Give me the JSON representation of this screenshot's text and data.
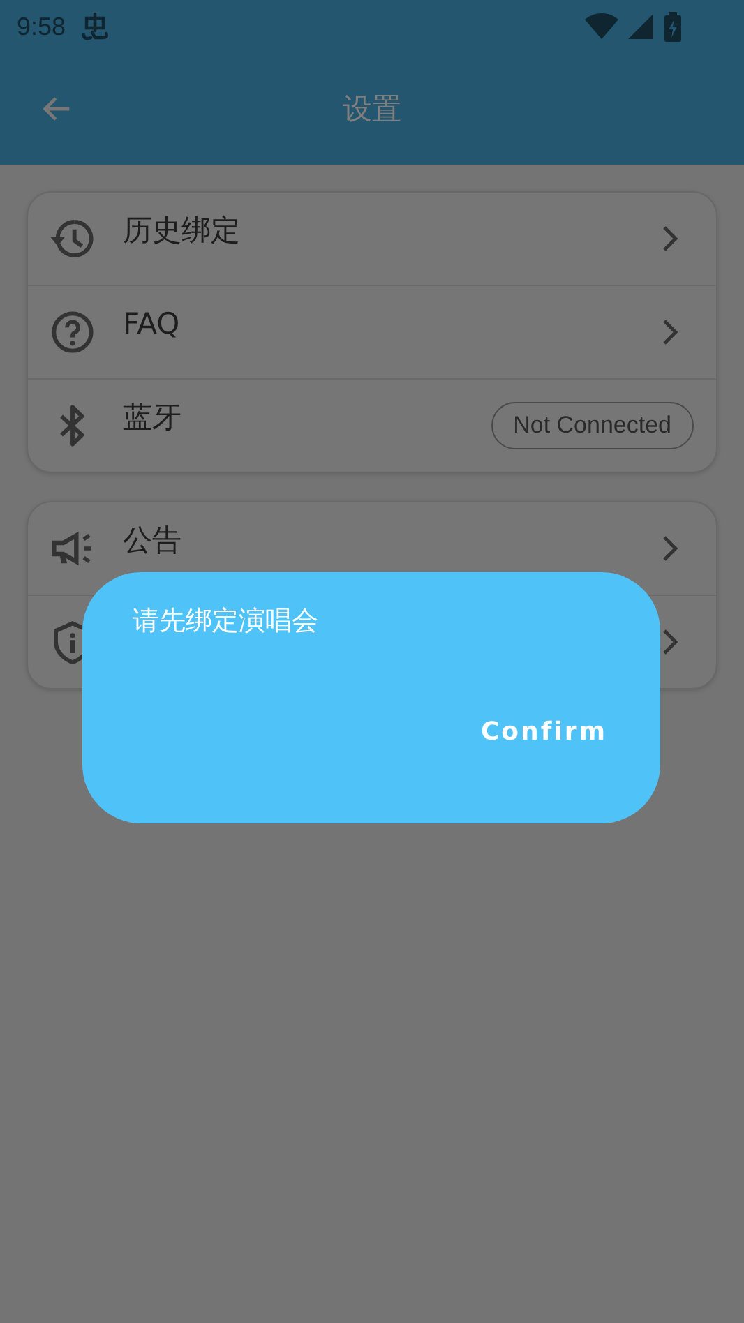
{
  "status_bar": {
    "time": "9:58"
  },
  "app_bar": {
    "title": "设置"
  },
  "groups": [
    {
      "rows": [
        {
          "kind": "link",
          "label": "历史绑定"
        },
        {
          "kind": "link",
          "label": "FAQ"
        },
        {
          "kind": "status",
          "label": "蓝牙",
          "badge": "Not Connected"
        }
      ]
    },
    {
      "rows": [
        {
          "kind": "link",
          "label": "公告"
        },
        {
          "kind": "link"
        }
      ]
    }
  ],
  "dialog": {
    "message": "请先绑定演唱会",
    "buttons": [
      "Confirm"
    ]
  }
}
